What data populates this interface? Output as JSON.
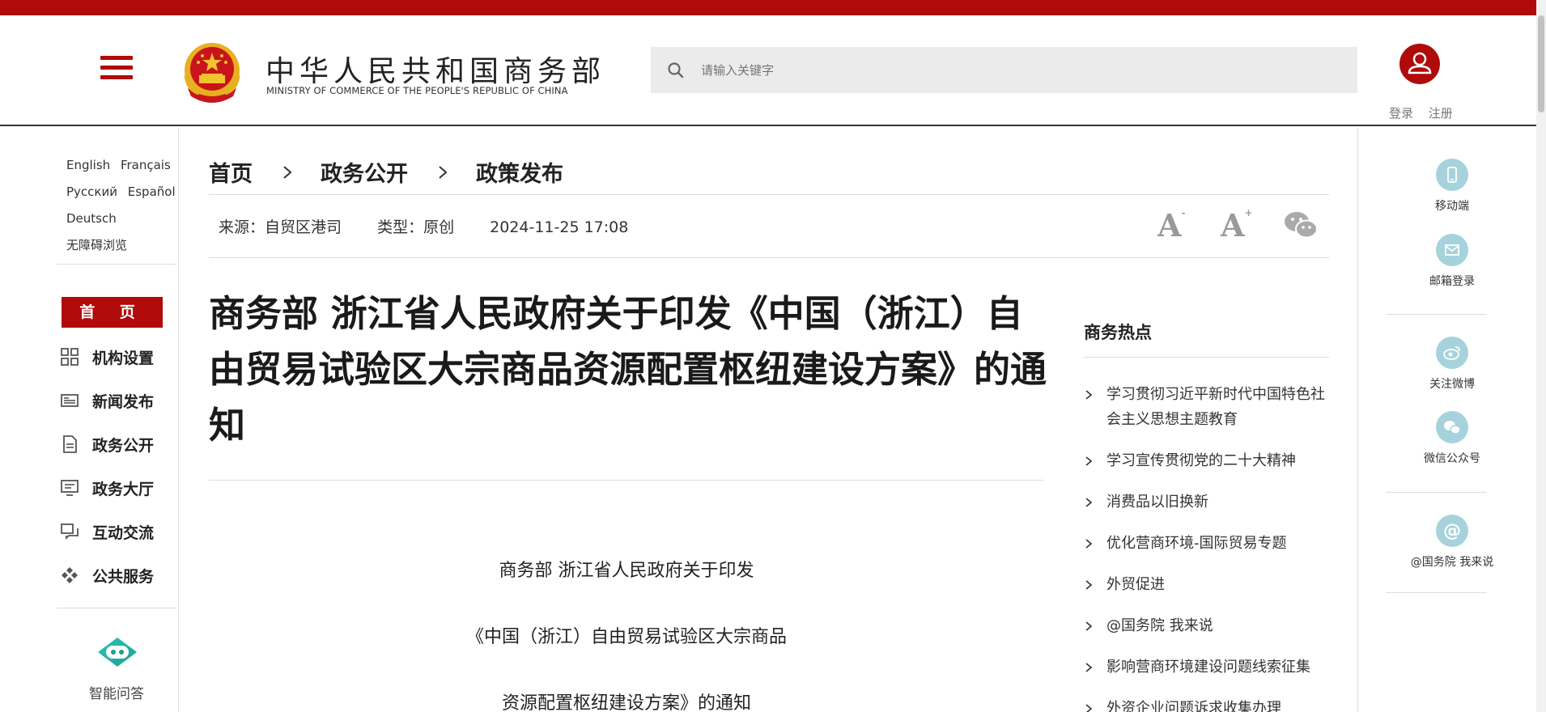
{
  "site": {
    "name_cn": "中华人民共和国商务部",
    "name_en": "MINISTRY OF COMMERCE OF THE PEOPLE'S REPUBLIC OF CHINA"
  },
  "search": {
    "placeholder": "请输入关键字"
  },
  "auth": {
    "login": "登录",
    "register": "注册"
  },
  "languages": {
    "row1": [
      "English",
      "Français"
    ],
    "row2": [
      "Русский",
      "Español"
    ],
    "row3": [
      "Deutsch"
    ],
    "accessible": "无障碍浏览"
  },
  "nav": {
    "home": "首 页",
    "items": [
      {
        "label": "机构设置",
        "icon": "grid-icon"
      },
      {
        "label": "新闻发布",
        "icon": "newspaper-icon"
      },
      {
        "label": "政务公开",
        "icon": "document-icon"
      },
      {
        "label": "政务大厅",
        "icon": "monitor-icon"
      },
      {
        "label": "互动交流",
        "icon": "chat-icon"
      },
      {
        "label": "公共服务",
        "icon": "service-icon"
      }
    ],
    "assistant": "智能问答"
  },
  "breadcrumb": [
    "首页",
    "政务公开",
    "政策发布"
  ],
  "meta": {
    "source": "来源：自贸区港司",
    "type": "类型：原创",
    "datetime": "2024-11-25 17:08",
    "font_decrease": "A",
    "font_increase": "A"
  },
  "article": {
    "title": "商务部 浙江省人民政府关于印发《中国（浙江）自由贸易试验区大宗商品资源配置枢纽建设方案》的通知",
    "lines": [
      "商务部 浙江省人民政府关于印发",
      "《中国（浙江）自由贸易试验区大宗商品",
      "资源配置枢纽建设方案》的通知"
    ]
  },
  "hot": {
    "title": "商务热点",
    "items": [
      "学习贯彻习近平新时代中国特色社会主义思想主题教育",
      "学习宣传贯彻党的二十大精神",
      "消费品以旧换新",
      "优化营商环境-国际贸易专题",
      "外贸促进",
      "@国务院 我来说",
      "影响营商环境建设问题线索征集",
      "外资企业问题诉求收集办理"
    ]
  },
  "right_panel": {
    "mobile": "移动端",
    "mail": "邮箱登录",
    "weibo": "关注微博",
    "wechat": "微信公众号",
    "state_council": "@国务院 我来说"
  },
  "colors": {
    "brand_red": "#b00a0a",
    "icon_teal": "#a6d3db"
  }
}
